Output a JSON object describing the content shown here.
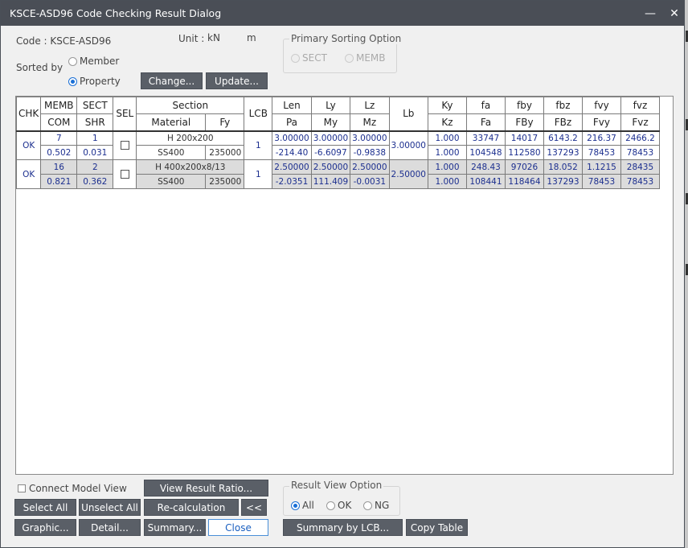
{
  "window": {
    "title": "KSCE-ASD96 Code Checking Result Dialog"
  },
  "header": {
    "code_label": "Code : KSCE-ASD96",
    "unit_label": "Unit :",
    "unit_force": "kN",
    "unit_length": "m",
    "sorted_by_label": "Sorted by",
    "sort_member": "Member",
    "sort_property": "Property",
    "sort_selected": "Property",
    "change_button": "Change...",
    "update_button": "Update..."
  },
  "primary_sorting": {
    "title": "Primary Sorting Option",
    "opt_sect": "SECT",
    "opt_memb": "MEMB"
  },
  "table": {
    "headers_top": [
      "CHK",
      "MEMB",
      "SECT",
      "SEL",
      "Section",
      "LCB",
      "Len",
      "Ly",
      "Lz",
      "Lb",
      "Ky",
      "fa",
      "fby",
      "fbz",
      "fvy",
      "fvz"
    ],
    "headers_bottom": [
      "COM",
      "SHR",
      "Material",
      "Fy",
      "Pa",
      "My",
      "Mz",
      "Kz",
      "Fa",
      "FBy",
      "FBz",
      "Fvy",
      "Fvz"
    ],
    "rows": [
      {
        "chk": "OK",
        "memb": "7",
        "sect": "1",
        "section": "H 200x200",
        "lcb": "1",
        "len": "3.00000",
        "ly": "3.00000",
        "lz": "3.00000",
        "lb": "3.00000",
        "ky": "1.000",
        "fa": "33747",
        "fby": "14017",
        "fbz": "6143.2",
        "fvy": "216.37",
        "fvz": "2466.2",
        "com": "0.502",
        "shr": "0.031",
        "material": "SS400",
        "fy": "235000",
        "pa": "-214.40",
        "my": "-6.6097",
        "mz": "-0.9838",
        "kz": "1.000",
        "Fa": "104548",
        "FBy": "112580",
        "FBz": "137293",
        "Fvy": "78453",
        "Fvz": "78453"
      },
      {
        "chk": "OK",
        "memb": "16",
        "sect": "2",
        "section": "H 400x200x8/13",
        "lcb": "1",
        "len": "2.50000",
        "ly": "2.50000",
        "lz": "2.50000",
        "lb": "2.50000",
        "ky": "1.000",
        "fa": "248.43",
        "fby": "97026",
        "fbz": "18.052",
        "fvy": "1.1215",
        "fvz": "28435",
        "com": "0.821",
        "shr": "0.362",
        "material": "SS400",
        "fy": "235000",
        "pa": "-2.0351",
        "my": "111.409",
        "mz": "-0.0031",
        "kz": "1.000",
        "Fa": "108441",
        "FBy": "118464",
        "FBz": "137293",
        "Fvy": "78453",
        "Fvz": "78453"
      }
    ]
  },
  "footer": {
    "connect_model_view": "Connect Model View",
    "view_result_ratio": "View Result Ratio...",
    "select_all": "Select All",
    "unselect_all": "Unselect All",
    "recalculation": "Re-calculation",
    "collapse": "<<",
    "graphic": "Graphic...",
    "detail": "Detail...",
    "summary": "Summary...",
    "close": "Close",
    "summary_by_lcb": "Summary by LCB...",
    "copy_table": "Copy Table"
  },
  "result_view": {
    "title": "Result View Option",
    "opt_all": "All",
    "opt_ok": "OK",
    "opt_ng": "NG",
    "selected": "All"
  }
}
